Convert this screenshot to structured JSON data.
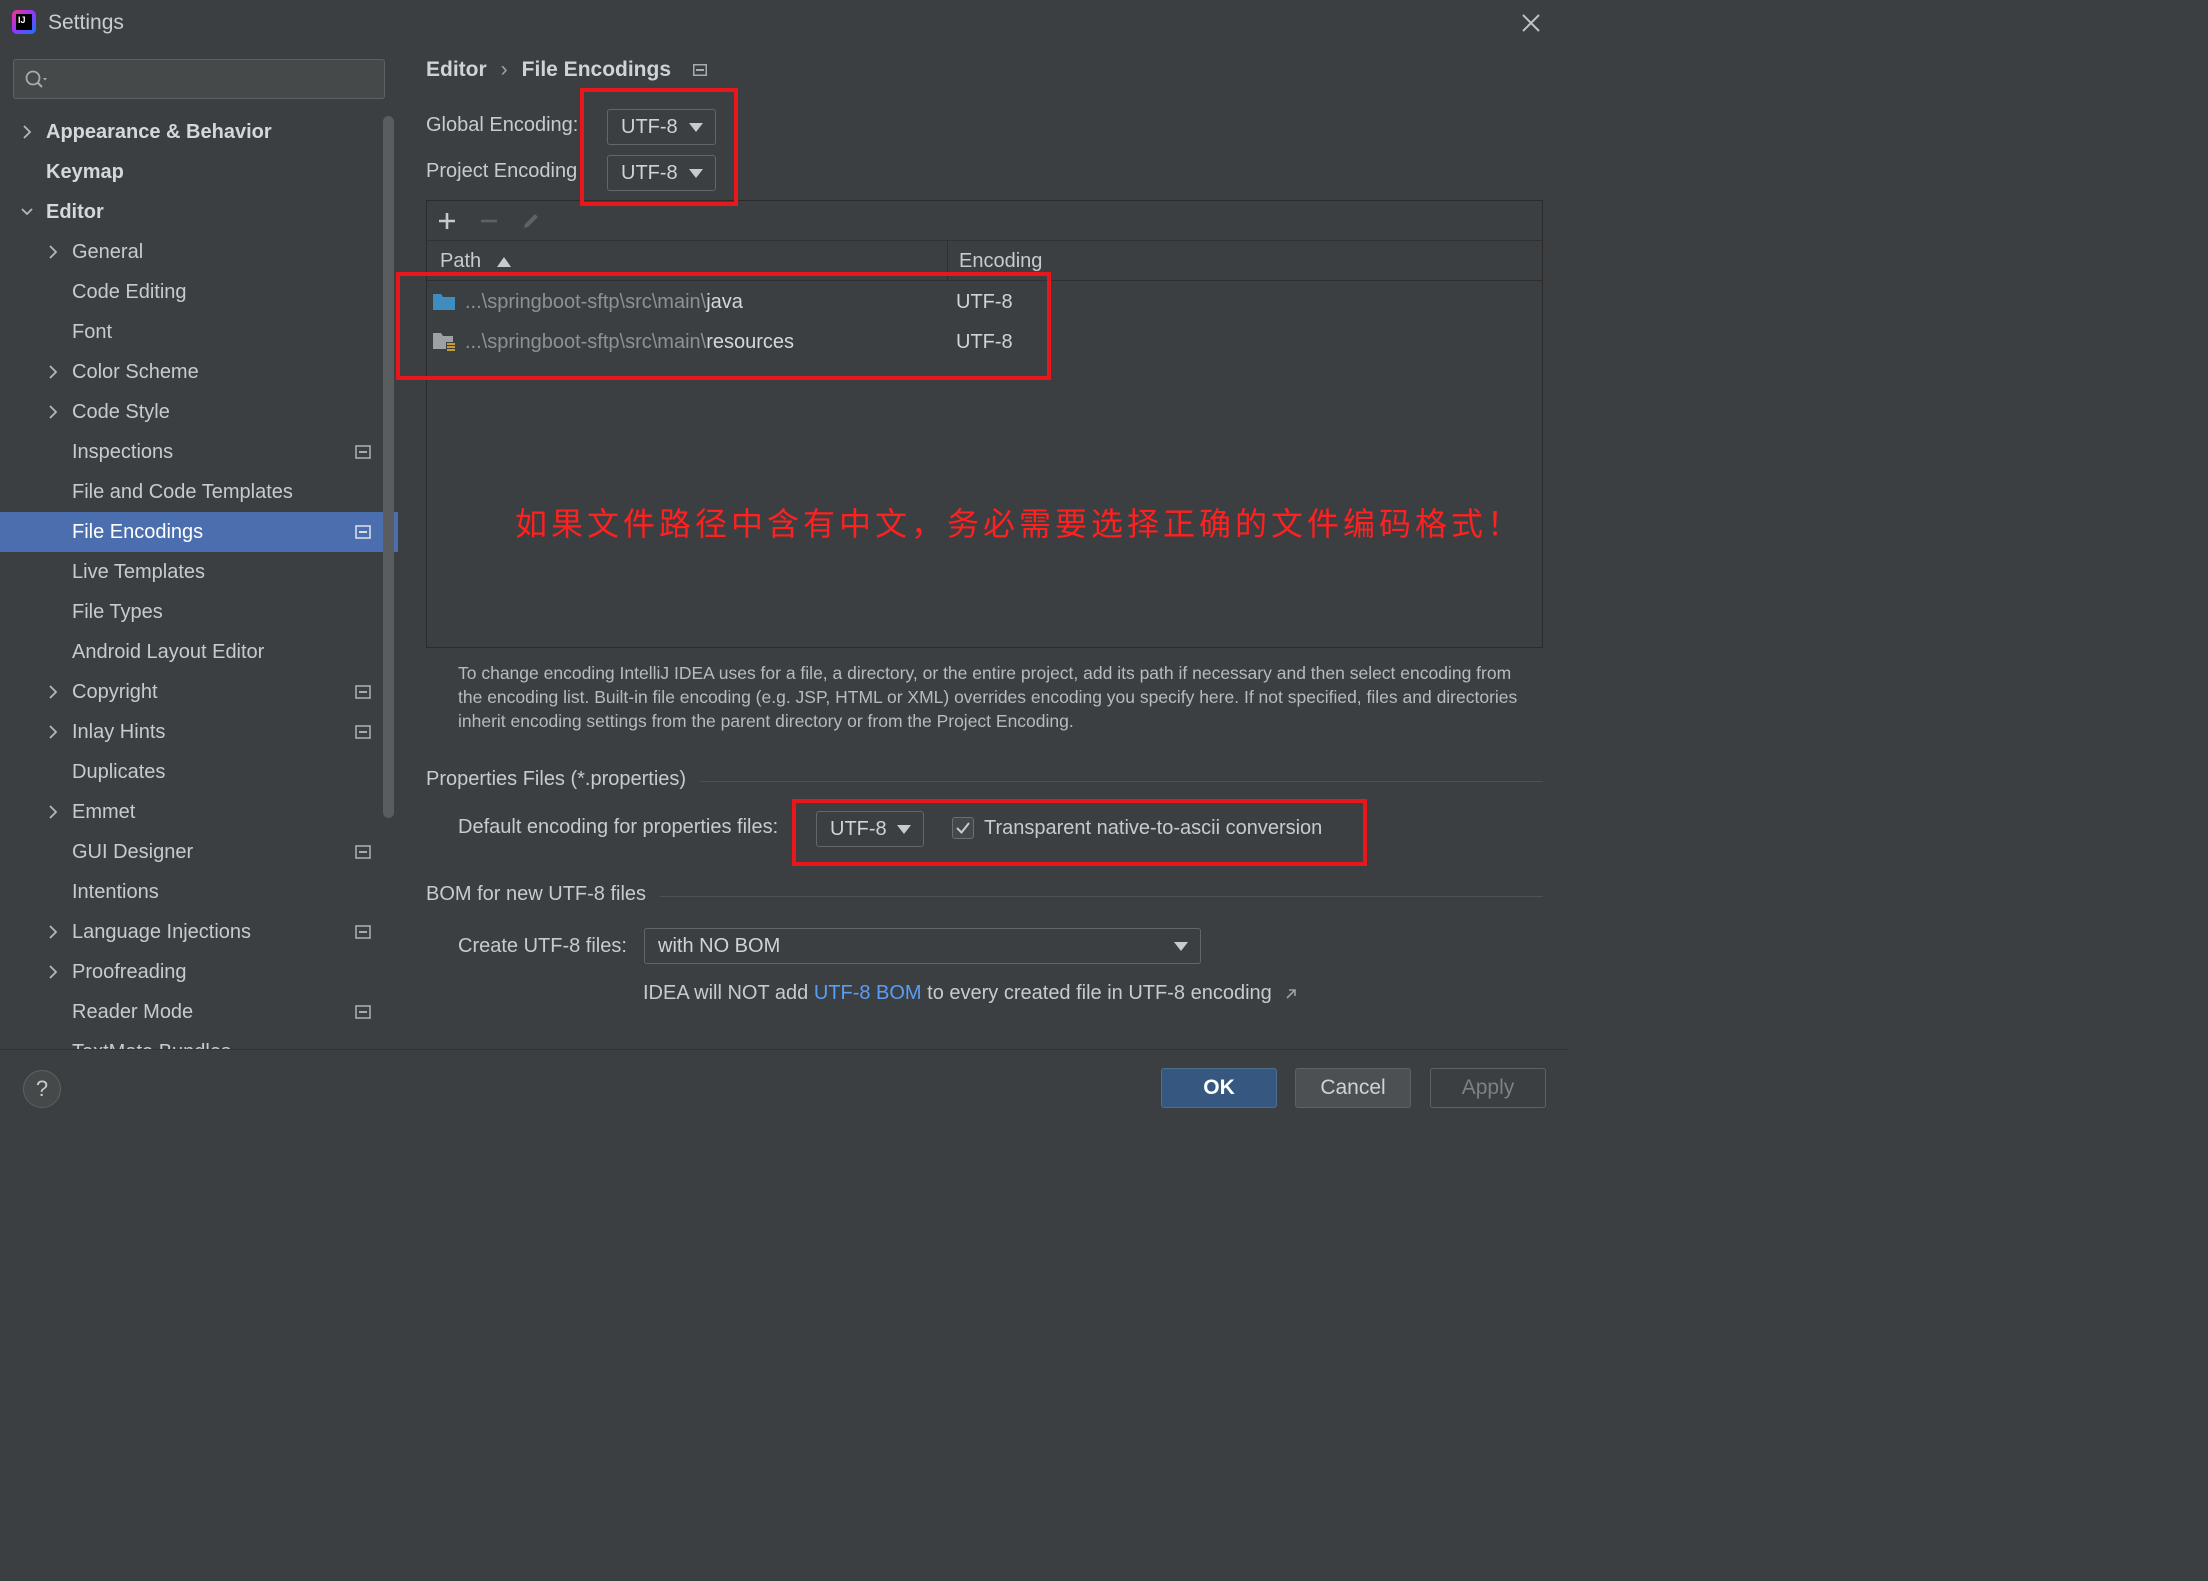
{
  "window": {
    "title": "Settings",
    "app_icon_text": "IJ"
  },
  "search": {
    "placeholder": "",
    "icon": "search-icon"
  },
  "sidebar": {
    "items": [
      {
        "label": "Appearance & Behavior",
        "level": 0,
        "bold": true,
        "chevron": "right",
        "project_icon": false,
        "selected": false
      },
      {
        "label": "Keymap",
        "level": 0,
        "bold": true,
        "chevron": "none",
        "project_icon": false,
        "selected": false
      },
      {
        "label": "Editor",
        "level": 0,
        "bold": true,
        "chevron": "down",
        "project_icon": false,
        "selected": false
      },
      {
        "label": "General",
        "level": 1,
        "bold": false,
        "chevron": "right",
        "project_icon": false,
        "selected": false
      },
      {
        "label": "Code Editing",
        "level": 1,
        "bold": false,
        "chevron": "none",
        "project_icon": false,
        "selected": false
      },
      {
        "label": "Font",
        "level": 1,
        "bold": false,
        "chevron": "none",
        "project_icon": false,
        "selected": false
      },
      {
        "label": "Color Scheme",
        "level": 1,
        "bold": false,
        "chevron": "right",
        "project_icon": false,
        "selected": false
      },
      {
        "label": "Code Style",
        "level": 1,
        "bold": false,
        "chevron": "right",
        "project_icon": false,
        "selected": false
      },
      {
        "label": "Inspections",
        "level": 1,
        "bold": false,
        "chevron": "none",
        "project_icon": true,
        "selected": false
      },
      {
        "label": "File and Code Templates",
        "level": 1,
        "bold": false,
        "chevron": "none",
        "project_icon": false,
        "selected": false
      },
      {
        "label": "File Encodings",
        "level": 1,
        "bold": false,
        "chevron": "none",
        "project_icon": true,
        "selected": true
      },
      {
        "label": "Live Templates",
        "level": 1,
        "bold": false,
        "chevron": "none",
        "project_icon": false,
        "selected": false
      },
      {
        "label": "File Types",
        "level": 1,
        "bold": false,
        "chevron": "none",
        "project_icon": false,
        "selected": false
      },
      {
        "label": "Android Layout Editor",
        "level": 1,
        "bold": false,
        "chevron": "none",
        "project_icon": false,
        "selected": false
      },
      {
        "label": "Copyright",
        "level": 1,
        "bold": false,
        "chevron": "right",
        "project_icon": true,
        "selected": false
      },
      {
        "label": "Inlay Hints",
        "level": 1,
        "bold": false,
        "chevron": "right",
        "project_icon": true,
        "selected": false
      },
      {
        "label": "Duplicates",
        "level": 1,
        "bold": false,
        "chevron": "none",
        "project_icon": false,
        "selected": false
      },
      {
        "label": "Emmet",
        "level": 1,
        "bold": false,
        "chevron": "right",
        "project_icon": false,
        "selected": false
      },
      {
        "label": "GUI Designer",
        "level": 1,
        "bold": false,
        "chevron": "none",
        "project_icon": true,
        "selected": false
      },
      {
        "label": "Intentions",
        "level": 1,
        "bold": false,
        "chevron": "none",
        "project_icon": false,
        "selected": false
      },
      {
        "label": "Language Injections",
        "level": 1,
        "bold": false,
        "chevron": "right",
        "project_icon": true,
        "selected": false
      },
      {
        "label": "Proofreading",
        "level": 1,
        "bold": false,
        "chevron": "right",
        "project_icon": false,
        "selected": false
      },
      {
        "label": "Reader Mode",
        "level": 1,
        "bold": false,
        "chevron": "none",
        "project_icon": true,
        "selected": false
      },
      {
        "label": "TextMate Bundles",
        "level": 1,
        "bold": false,
        "chevron": "none",
        "project_icon": false,
        "selected": false
      }
    ]
  },
  "breadcrumb": {
    "parent": "Editor",
    "separator": "›",
    "current": "File Encodings"
  },
  "encodings": {
    "global_label": "Global Encoding:",
    "global_value": "UTF-8",
    "project_label": "Project Encoding",
    "project_value": "UTF-8"
  },
  "table": {
    "columns": {
      "path": "Path",
      "encoding": "Encoding"
    },
    "rows": [
      {
        "path_prefix": "...\\springboot-sftp\\src\\main\\",
        "path_name": "java",
        "encoding": "UTF-8",
        "icon": "folder-icon"
      },
      {
        "path_prefix": "...\\springboot-sftp\\src\\main\\",
        "path_name": "resources",
        "encoding": "UTF-8",
        "icon": "resources-folder-icon"
      }
    ],
    "annotation": "如果文件路径中含有中文，务必需要选择正确的文件编码格式！"
  },
  "description": "To change encoding IntelliJ IDEA uses for a file, a directory, or the entire project, add its path if necessary and then select encoding from the encoding list. Built-in file encoding (e.g. JSP, HTML or XML) overrides encoding you specify here. If not specified, files and directories inherit encoding settings from the parent directory or from the Project Encoding.",
  "properties": {
    "group_title": "Properties Files (*.properties)",
    "default_label": "Default encoding for properties files:",
    "default_value": "UTF-8",
    "transparent_label": "Transparent native-to-ascii conversion",
    "transparent_checked": true
  },
  "bom": {
    "group_title": "BOM for new UTF-8 files",
    "create_label": "Create UTF-8 files:",
    "create_value": "with NO BOM",
    "hint_before": "IDEA will NOT add ",
    "hint_link": "UTF-8 BOM",
    "hint_after": " to every created file in UTF-8 encoding"
  },
  "footer": {
    "help": "?",
    "ok": "OK",
    "cancel": "Cancel",
    "apply": "Apply"
  },
  "colors": {
    "accent": "#4b6eaf",
    "annotation": "#e8171b",
    "link": "#589df6",
    "ok_button": "#365880"
  }
}
